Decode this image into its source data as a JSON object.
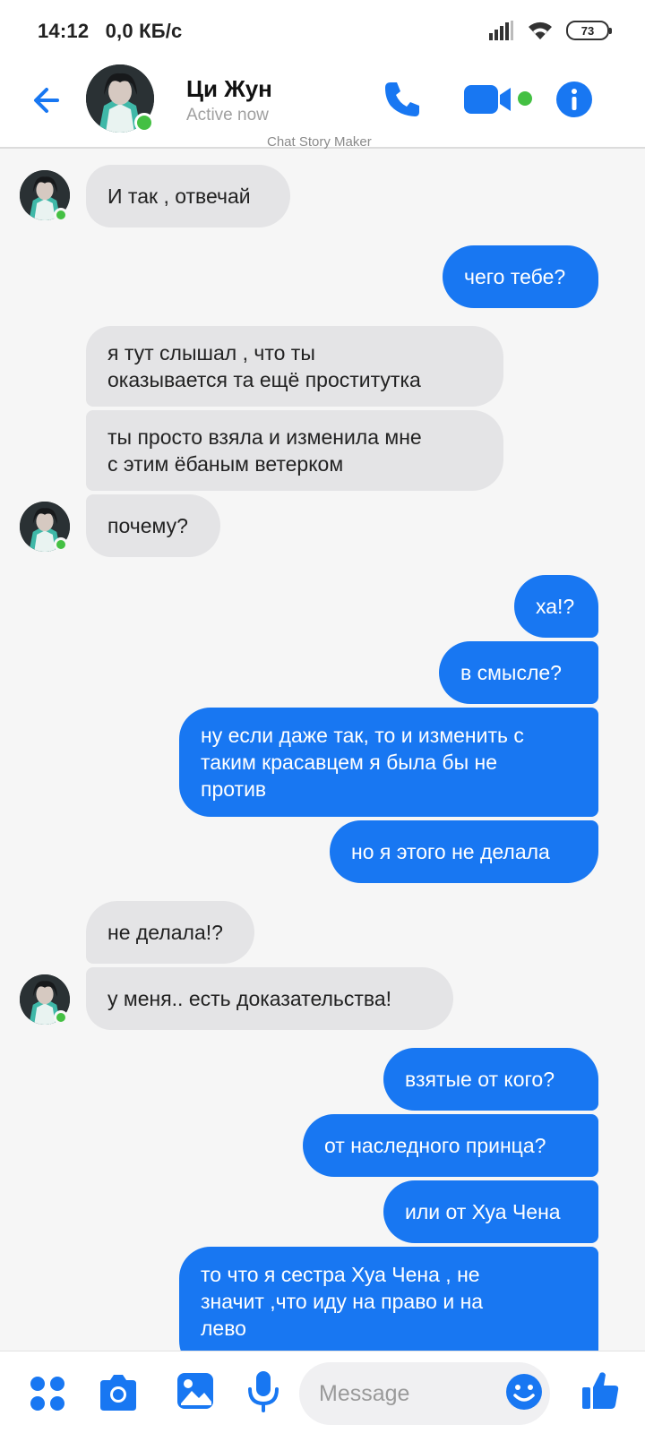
{
  "status_bar": {
    "time": "14:12",
    "net_speed": "0,0 КБ/с",
    "battery": "73"
  },
  "header": {
    "name": "Ци Жун",
    "status": "Active now",
    "watermark": "Chat Story Maker"
  },
  "messages": [
    {
      "dir": "in",
      "text": "И так , отвечай"
    },
    {
      "dir": "out",
      "text": "чего тебе?"
    },
    {
      "dir": "in",
      "text": "я тут слышал , что ты\nоказывается та ещё проститутка"
    },
    {
      "dir": "in",
      "text": "ты просто взяла и изменила мне\nс этим ёбаным ветерком"
    },
    {
      "dir": "in",
      "text": "почему?"
    },
    {
      "dir": "out",
      "text": "ха!?"
    },
    {
      "dir": "out",
      "text": "в смысле?"
    },
    {
      "dir": "out",
      "text": "ну если даже так, то и изменить с\nтаким красавцем я была бы не\nпротив"
    },
    {
      "dir": "out",
      "text": "но я этого не делала"
    },
    {
      "dir": "in",
      "text": "не делала!?"
    },
    {
      "dir": "in",
      "text": "у меня.. есть доказательства!"
    },
    {
      "dir": "out",
      "text": "взятые от кого?"
    },
    {
      "dir": "out",
      "text": "от наследного принца?"
    },
    {
      "dir": "out",
      "text": "или от Хуа Чена"
    },
    {
      "dir": "out",
      "text": "то что я сестра Хуа Чена , не\nзначит ,что иду на право и на\nлево"
    }
  ],
  "composer": {
    "placeholder": "Message"
  },
  "colors": {
    "accent": "#1877f2",
    "online": "#44c043",
    "incoming_bubble": "#e4e4e6"
  },
  "icons": [
    "back-arrow-icon",
    "phone-icon",
    "video-camera-icon",
    "info-icon",
    "apps-icon",
    "camera-icon",
    "gallery-icon",
    "microphone-icon",
    "emoji-icon",
    "thumbs-up-icon"
  ]
}
